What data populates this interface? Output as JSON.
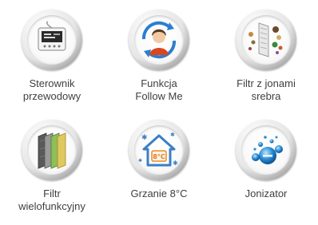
{
  "features": [
    {
      "id": "wired-controller",
      "icon": "wired-controller-icon",
      "label_lines": [
        "Sterownik",
        "przewodowy"
      ]
    },
    {
      "id": "follow-me",
      "icon": "follow-me-icon",
      "label_lines": [
        "Funkcja",
        "Follow Me"
      ]
    },
    {
      "id": "silver-ion-filter",
      "icon": "silver-ion-filter-icon",
      "label_lines": [
        "Filtr z jonami",
        "srebra"
      ]
    },
    {
      "id": "multifunction-filter",
      "icon": "multifunction-filter-icon",
      "label_lines": [
        "Filtr",
        "wielofunkcyjny"
      ]
    },
    {
      "id": "heating-8c",
      "icon": "heating-house-icon",
      "label_lines": [
        "Grzanie 8°C"
      ],
      "icon_text": "8°C"
    },
    {
      "id": "ionizer",
      "icon": "ionizer-icon",
      "label_lines": [
        "Jonizator"
      ]
    }
  ],
  "colors": {
    "label_text": "#3f3f3f",
    "badge_ring": "#9a9a9a",
    "ion_blue": "#2a8fd6",
    "house_blue": "#3a7fc4",
    "heat_orange": "#e88a2a"
  }
}
